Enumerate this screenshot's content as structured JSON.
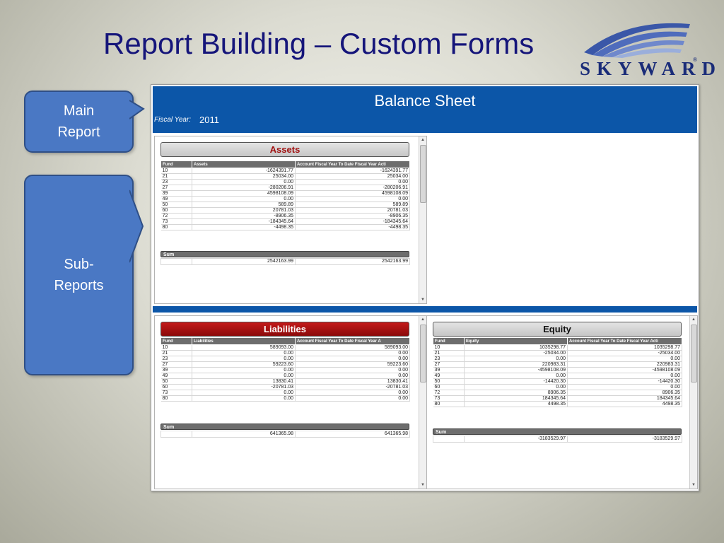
{
  "slide": {
    "title": "Report Building – Custom Forms"
  },
  "logo": {
    "text": "SKYWARD",
    "reg": "®"
  },
  "callouts": {
    "main": [
      "Main",
      "Report"
    ],
    "sub": [
      "Sub-",
      "Reports"
    ]
  },
  "report": {
    "title": "Balance Sheet",
    "fiscal_label": "Fiscal Year:",
    "fiscal_value": "2011"
  },
  "assets": {
    "title": "Assets",
    "columns": [
      "Fund",
      "Assets",
      "Account Fiscal Year To Date Fiscal Year Acti"
    ],
    "rows": [
      [
        "10",
        "-1624391.77",
        "-1624391.77"
      ],
      [
        "21",
        "25034.00",
        "25034.00"
      ],
      [
        "23",
        "0.00",
        "0.00"
      ],
      [
        "27",
        "-280206.91",
        "-280206.91"
      ],
      [
        "39",
        "4598108.09",
        "4598108.09"
      ],
      [
        "49",
        "0.00",
        "0.00"
      ],
      [
        "50",
        "589.89",
        "589.89"
      ],
      [
        "60",
        "20781.03",
        "20781.03"
      ],
      [
        "72",
        "-8906.35",
        "-8906.35"
      ],
      [
        "73",
        "-184345.64",
        "-184345.64"
      ],
      [
        "80",
        "-4498.35",
        "-4498.35"
      ]
    ],
    "sum_label": "Sum",
    "sum": [
      "",
      "2542163.99",
      "2542163.99"
    ]
  },
  "liabilities": {
    "title": "Liabilities",
    "columns": [
      "Fund",
      "Liabilities",
      "Account Fiscal Year To Date Fiscal Year A"
    ],
    "rows": [
      [
        "10",
        "589093.00",
        "589093.00"
      ],
      [
        "21",
        "0.00",
        "0.00"
      ],
      [
        "23",
        "0.00",
        "0.00"
      ],
      [
        "27",
        "59223.60",
        "59223.60"
      ],
      [
        "39",
        "0.00",
        "0.00"
      ],
      [
        "49",
        "0.00",
        "0.00"
      ],
      [
        "50",
        "13830.41",
        "13830.41"
      ],
      [
        "60",
        "-20781.03",
        "-20781.03"
      ],
      [
        "73",
        "0.00",
        "0.00"
      ],
      [
        "80",
        "0.00",
        "0.00"
      ]
    ],
    "sum_label": "Sum",
    "sum": [
      "",
      "641365.98",
      "641365.98"
    ]
  },
  "equity": {
    "title": "Equity",
    "columns": [
      "Fund",
      "Equity",
      "Account Fiscal Year To Date Fiscal Year Acti"
    ],
    "rows": [
      [
        "10",
        "1035298.77",
        "1035298.77"
      ],
      [
        "21",
        "-25034.00",
        "-25034.00"
      ],
      [
        "23",
        "0.00",
        "0.00"
      ],
      [
        "27",
        "220983.31",
        "220983.31"
      ],
      [
        "39",
        "-4598108.09",
        "-4598108.09"
      ],
      [
        "49",
        "0.00",
        "0.00"
      ],
      [
        "50",
        "-14420.30",
        "-14420.30"
      ],
      [
        "60",
        "0.00",
        "0.00"
      ],
      [
        "72",
        "8906.35",
        "8906.35"
      ],
      [
        "73",
        "184345.64",
        "184345.64"
      ],
      [
        "80",
        "4498.35",
        "4498.35"
      ]
    ],
    "sum_label": "Sum",
    "sum": [
      "",
      "-3183529.97",
      "-3183529.97"
    ]
  },
  "colors": {
    "title_text": "#15157a",
    "callout_fill": "#4a78c4",
    "report_header": "#0c56a8",
    "liabilities_header": "#b01414",
    "assets_title_text": "#a01010"
  }
}
